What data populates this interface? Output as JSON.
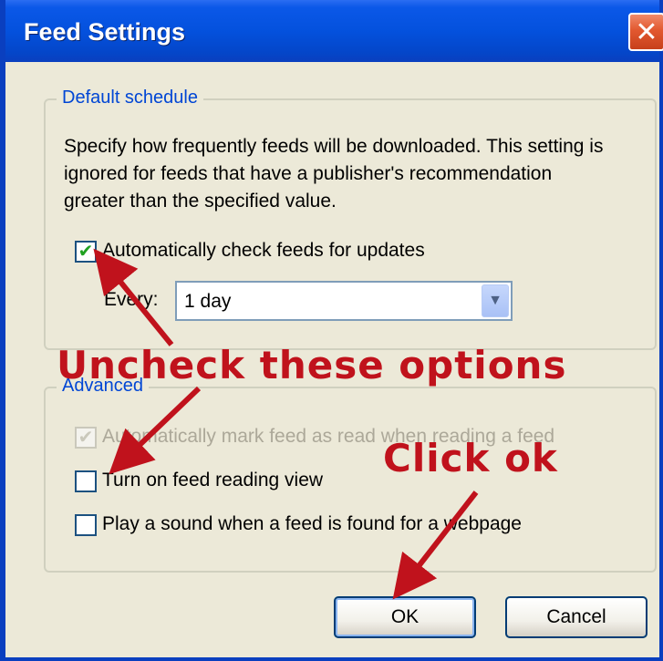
{
  "window": {
    "title": "Feed Settings",
    "close_glyph": "✕",
    "title_color": "#0451dd"
  },
  "default_schedule": {
    "legend": "Default schedule",
    "description": "Specify how frequently feeds will be downloaded. This setting is ignored for feeds that have a publisher's recommendation greater than the specified value.",
    "auto_check": {
      "label": "Automatically check feeds for updates",
      "checked": true
    },
    "every": {
      "label": "Every:",
      "value": "1 day"
    }
  },
  "advanced": {
    "legend": "Advanced",
    "options": [
      {
        "label": "Automatically mark feed as read when reading a feed",
        "checked": true,
        "disabled": true
      },
      {
        "label": "Turn on feed reading view",
        "checked": false,
        "disabled": false
      },
      {
        "label": "Play a sound when a feed is found for a webpage",
        "checked": false,
        "disabled": false
      }
    ]
  },
  "buttons": {
    "ok": "OK",
    "cancel": "Cancel"
  },
  "annotations": {
    "uncheck": "Uncheck these options",
    "click_ok": "Click ok",
    "color": "#c0121c"
  },
  "icons": {
    "check": "checkmark-icon",
    "dropdown": "chevron-down-icon",
    "close": "close-icon"
  }
}
